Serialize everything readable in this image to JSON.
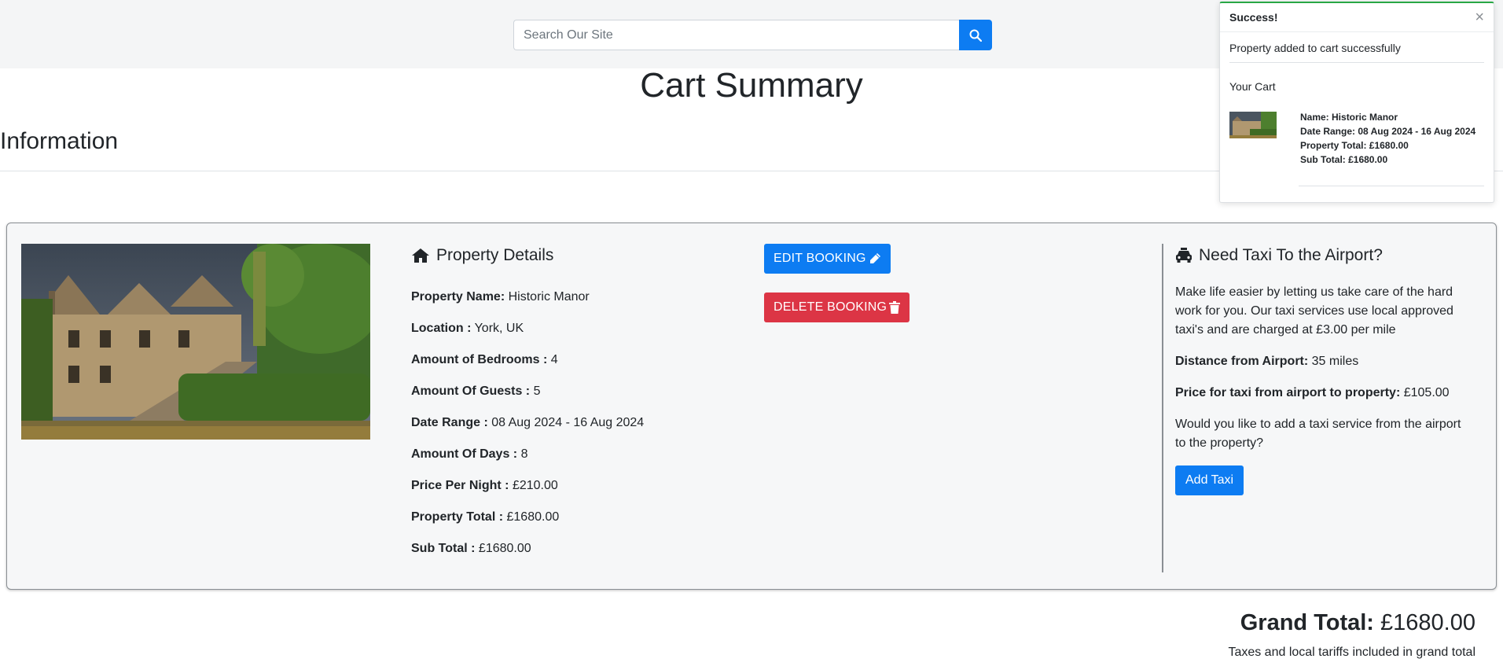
{
  "search": {
    "placeholder": "Search Our Site"
  },
  "page": {
    "title": "Cart Summary",
    "section": "Information"
  },
  "property": {
    "heading": "Property Details",
    "rows": [
      {
        "label": "Property Name:",
        "value": "Historic Manor"
      },
      {
        "label": "Location :",
        "value": "York, UK"
      },
      {
        "label": "Amount of Bedrooms :",
        "value": "4"
      },
      {
        "label": "Amount Of Guests :",
        "value": "5"
      },
      {
        "label": "Date Range :",
        "value": "08 Aug 2024 - 16 Aug 2024"
      },
      {
        "label": "Amount Of Days :",
        "value": "8"
      },
      {
        "label": "Price Per Night :",
        "value": "£210.00"
      },
      {
        "label": "Property Total :",
        "value": "£1680.00"
      },
      {
        "label": "Sub Total :",
        "value": "£1680.00"
      }
    ]
  },
  "actions": {
    "edit_label": "EDIT BOOKING",
    "delete_label": "DELETE BOOKING"
  },
  "taxi": {
    "heading": "Need Taxi To the Airport?",
    "intro": "Make life easier by letting us take care of the hard work for you. Our taxi services use local approved taxi's and are charged at £3.00 per mile",
    "distance_label": "Distance from Airport:",
    "distance_value": "35 miles",
    "price_label": "Price for taxi from airport to property:",
    "price_value": "£105.00",
    "question": "Would you like to add a taxi service from the airport to the property?",
    "button_label": "Add Taxi"
  },
  "totals": {
    "grand_label": "Grand Total:",
    "grand_value": "£1680.00",
    "note": "Taxes and local tariffs included in grand total"
  },
  "toast": {
    "title": "Success!",
    "close": "×",
    "message": "Property added to cart successfully",
    "cart_label": "Your Cart",
    "item": {
      "name": "Name: Historic Manor",
      "dates": "Date Range: 08 Aug 2024 - 16 Aug 2024",
      "property_total": "Property Total: £1680.00",
      "sub_total": "Sub Total: £1680.00"
    }
  },
  "colors": {
    "primary": "#0d7cf2",
    "danger": "#dc3545",
    "success": "#28a745"
  },
  "icons": [
    "search-icon",
    "home-icon",
    "pencil-icon",
    "trash-icon",
    "taxi-icon",
    "close-icon"
  ]
}
